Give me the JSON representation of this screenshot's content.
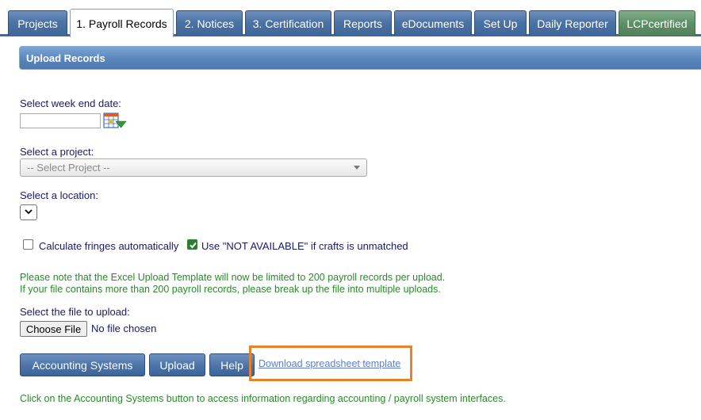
{
  "tabs": [
    {
      "label": "Projects",
      "active": false
    },
    {
      "label": "1. Payroll Records",
      "active": true
    },
    {
      "label": "2. Notices",
      "active": false
    },
    {
      "label": "3. Certification",
      "active": false
    },
    {
      "label": "Reports",
      "active": false
    },
    {
      "label": "eDocuments",
      "active": false
    },
    {
      "label": "Set Up",
      "active": false
    },
    {
      "label": "Daily Reporter",
      "active": false
    },
    {
      "label": "LCPcertified",
      "active": false
    }
  ],
  "panel": {
    "title": "Upload Records"
  },
  "form": {
    "week_end_label": "Select week end date:",
    "week_end_value": "",
    "project_label": "Select a project:",
    "project_selected": "-- Select Project --",
    "location_label": "Select a location:",
    "location_selected": "",
    "calc_fringes_label": "Calculate fringes automatically",
    "calc_fringes_checked": false,
    "not_available_label": "Use \"NOT AVAILABLE\" if crafts is unmatched",
    "not_available_checked": true,
    "note_line1": "Please note that the Excel Upload Template will now be limited to 200 payroll records per upload.",
    "note_line2": "If your file contains more than 200 payroll records, please break up the file into multiple uploads.",
    "file_label": "Select the file to upload:",
    "choose_file_label": "Choose File",
    "no_file_text": "No file chosen"
  },
  "buttons": {
    "accounting_systems": "Accounting Systems",
    "upload": "Upload",
    "help": "Help"
  },
  "download_link": "Download spreadsheet template",
  "footer_note": "Click on the Accounting Systems button to access information regarding accounting / payroll system interfaces.",
  "colors": {
    "tab_blue": "#4c73a6",
    "tab_green": "#5e9068",
    "note_green": "#2a8a2a",
    "highlight_orange": "#e8822a",
    "link_blue": "#5b7fcf"
  },
  "icons": {
    "calendar": "calendar-dropdown-icon",
    "checkmark": "checkmark-icon"
  }
}
